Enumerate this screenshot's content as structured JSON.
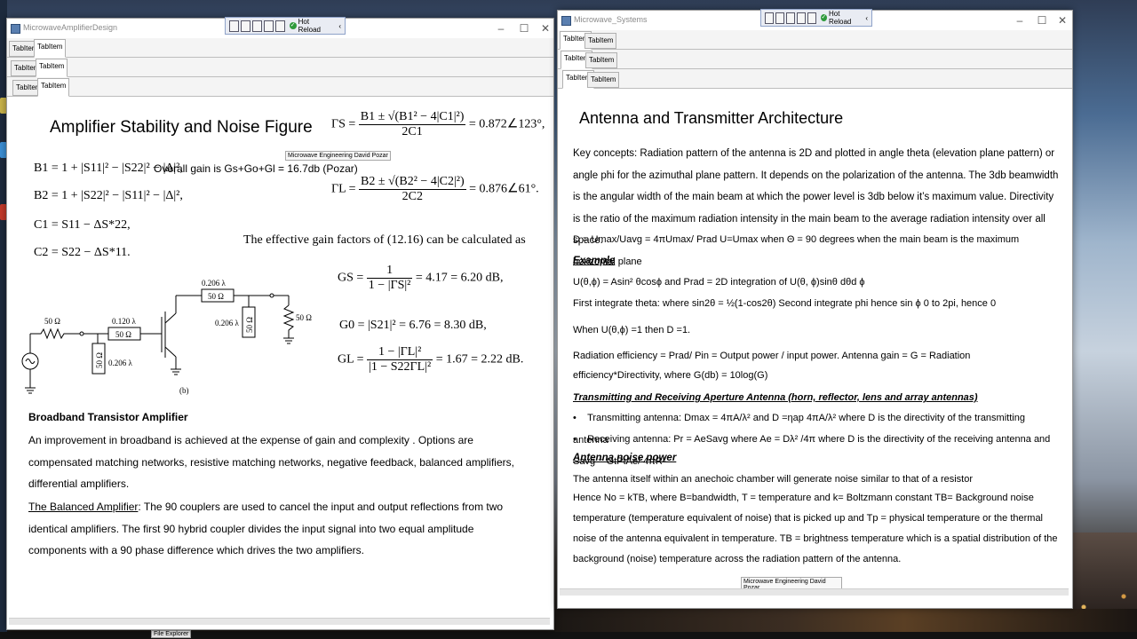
{
  "left_window": {
    "title": "MicrowaveAmplifierDesign",
    "devbar": {
      "hot_reload": "Hot Reload"
    },
    "tabs_row1": [
      "TabItem",
      "TabItem"
    ],
    "tabs_row2": [
      "TabItem",
      "TabItem"
    ],
    "tabs_row3": [
      "TabItem",
      "TabItem"
    ],
    "heading": "Amplifier Stability and Noise Figure",
    "tooltip": "Microwave Engineering David Pozar",
    "eq_b1": "B1 = 1 + |S11|² − |S22|² − |Δ|²,",
    "overall_gain": "Overall gain is Gs+Go+Gl = 16.7db (Pozar)",
    "eq_b2": "B2 = 1 + |S22|² − |S11|² − |Δ|²,",
    "eq_c1": "C1 = S11 − ΔS*22,",
    "eq_c2": "C2 = S22 − ΔS*11.",
    "gamma_s": {
      "lhs": "ΓS =",
      "num": "B1 ± √(B1² − 4|C1|²)",
      "den": "2C1",
      "rhs": "= 0.872∠123°,"
    },
    "gamma_l": {
      "lhs": "ΓL =",
      "num": "B2 ± √(B2² − 4|C2|²)",
      "den": "2C2",
      "rhs": "= 0.876∠61°."
    },
    "gain_factors_text": "The effective gain factors of (12.16) can be calculated as",
    "gs": {
      "lhs": "GS =",
      "num": "1",
      "den": "1 − |ΓS|²",
      "rhs": "= 4.17 = 6.20 dB,"
    },
    "g0": {
      "text": "G0 = |S21|² = 6.76 = 8.30 dB,"
    },
    "gl": {
      "lhs": "GL =",
      "num": "1 − |ΓL|²",
      "den": "|1 − S22ΓL|²",
      "rhs": "= 1.67 = 2.22 dB."
    },
    "circuit": {
      "r_source": "50 Ω",
      "len1": "0.120 λ",
      "r1": "50 Ω",
      "stub1": "0.206 λ",
      "r_stub1": "50 Ω",
      "len2": "0.206 λ",
      "r2": "50 Ω",
      "stub2": "0.206 λ",
      "r_stub2": "50 Ω",
      "r_load": "50 Ω",
      "caption": "(b)"
    },
    "broadband_title": "Broadband Transistor Amplifier",
    "broadband_body": "An improvement in broadband is achieved at the expense of gain and complexity . Options are compensated matching networks, resistive matching networks, negative feedback, balanced amplifiers, differential amplifiers.",
    "balanced_title": "The Balanced Amplifier",
    "balanced_body": ":  The 90 couplers are used to cancel the input and output reflections from two identical amplifiers. The first 90 hybrid coupler divides the input signal into two equal amplitude components with a  90 phase difference which drives the two amplifiers."
  },
  "right_window": {
    "title": "Microwave_Systems",
    "devbar": {
      "hot_reload": "Hot Reload"
    },
    "tabs_row1": [
      "TabItem",
      "TabItem"
    ],
    "tabs_row2": [
      "TabItem",
      "TabItem"
    ],
    "tabs_row3": [
      "TabItem",
      "TabItem"
    ],
    "heading": "Antenna and Transmitter Architecture",
    "key_concepts": "Key concepts: Radiation pattern of the antenna is 2D and plotted in angle theta (elevation plane pattern) or angle phi for the azimuthal plane pattern. It depends on the polarization of the antenna.  The 3db beamwidth is the angular width of the main beam at which the power level is 3db below it’s maximum value.  Directivity is the ratio of the maximum radiation intensity in the main beam to the average radiation intensity over all space.",
    "directivity_eq": "D = Umax/Uavg = 4πUmax/ Prad   U=Umax when Θ = 90 degrees  when the main beam is the maximum  horizontal plane",
    "example_title": "Example",
    "example_line1": "U(θ,ϕ) = Asin² θcosϕ and Prad = 2D integration of U(θ, ϕ)sinθ dθd ϕ",
    "example_line2": "First integrate theta:  where sin2θ = ½(1-cos2θ) Second integrate phi hence sin ϕ 0 to 2pi, hence 0",
    "example_line3": "When U(θ,ϕ) =1  then D =1.",
    "radiation_eff": "Radiation efficiency  = Prad/ Pin = Output power / input power.  Antenna gain = G = Radiation efficiency*Directivity, where G(db) = 10log(G)",
    "aperture_title": "Transmitting and Receiving Aperture Antenna (horn, reflector, lens and array antennas)",
    "bullet1": "Transmitting antenna: Dmax = 4πA/λ²  and D =ηap 4πA/λ² where D is the directivity of the transmitting antenna",
    "bullet2": "Receiving antenna: Pr = AeSavg  where Ae = Dλ² /4π  where D is the directivity of the receiving antenna and Savg = GtPtAe/ 4πR²",
    "noise_title": "Antenna noise power",
    "noise_line1": "The antenna itself within an anechoic chamber will generate noise similar to that of a resistor",
    "noise_body": "Hence No = kTB, where B=bandwidth, T = temperature and k= Boltzmann constant TB= Background noise temperature  (temperature equivalent of noise) that is picked up and Tp = physical temperature or the thermal noise of the antenna equivalent in temperature. TB = brightness temperature which is a spatial distribution of the background (noise) temperature across the radiation pattern of the antenna.",
    "tooltip": "Microwave Engineering David Pozar"
  },
  "taskbar": {
    "file_explorer": "File Explorer"
  }
}
